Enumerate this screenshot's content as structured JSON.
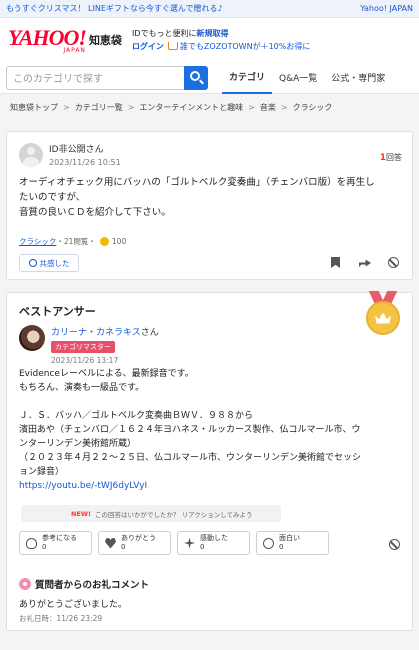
{
  "topbar": {
    "promo": "もうすぐクリスマス！ LINEギフトなら今すぐ選んで贈れる♪",
    "yahoo_link": "Yahoo! JAPAN"
  },
  "header": {
    "logo_text": "YAHOO!",
    "logo_sub": "JAPAN",
    "service": "知恵袋",
    "line1_prefix": "IDでもっと便利に",
    "line1_link": "新規取得",
    "login": "ログイン",
    "zozo": "誰でもZOZOTOWNが＋10%お得に"
  },
  "search": {
    "placeholder": "このカテゴリで探す"
  },
  "tabs": [
    {
      "label": "カテゴリ"
    },
    {
      "label": "Q&A一覧"
    },
    {
      "label": "公式・専門家"
    }
  ],
  "breadcrumb": [
    "知恵袋トップ",
    "カテゴリ一覧",
    "エンターテインメントと趣味",
    "音楽",
    "クラシック"
  ],
  "question": {
    "user": "ID非公開さん",
    "date": "2023/11/26 10:51",
    "answers_count": "1",
    "answers_label": "回答",
    "text_lines": [
      "オーディオチェック用にバッハの「ゴルトベルク変奏曲」（チェンバロ版）を再生し",
      "たいのですが、",
      "音質の良いＣＤを紹介して下さい。"
    ],
    "category": "クラシック",
    "views": "・21閲覧・",
    "coins": "100",
    "empathy": "共感した"
  },
  "best_answer": {
    "title": "ベストアンサー",
    "user": "カリーナ・カネラキス",
    "user_suffix": "さん",
    "badge": "カテゴリマスター",
    "date": "2023/11/26 13:17",
    "lines": [
      "Evidenceレーベルによる、最新録音です。",
      "もちろん、演奏も一級品です。",
      "",
      "Ｊ．Ｓ．バッハ／ゴルトベルク変奏曲ＢＷＶ．９８８から",
      "濱田あや（チェンバロ／１６２４年ヨハネス・ルッカース製作、仏コルマール市、ウ",
      "ンターリンデン美術館所蔵）",
      "（２０２３年４月２２～２５日、仏コルマール市、ウンターリンデン美術館でセッシ",
      "ョン録音）"
    ],
    "url": "https://youtu.be/-tWJ6dyLVyI",
    "new_label": "NEW!",
    "new_text": "この回答はいかがでしたか？ リアクションしてみよう",
    "reactions": [
      {
        "label": "参考になる",
        "count": "0"
      },
      {
        "label": "ありがとう",
        "count": "0"
      },
      {
        "label": "感動した",
        "count": "0"
      },
      {
        "label": "面白い",
        "count": "0"
      }
    ]
  },
  "thanks": {
    "title": "質問者からのお礼コメント",
    "text": "ありがとうございました。",
    "date": "お礼日時：11/26 23:29"
  }
}
